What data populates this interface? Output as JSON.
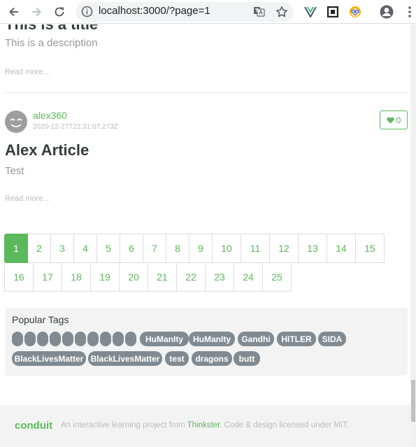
{
  "browser": {
    "url": "localhost:3000/?page=1",
    "icons": [
      "back-arrow-icon",
      "forward-arrow-icon",
      "reload-icon",
      "info-icon",
      "translate-icon",
      "star-icon",
      "vue-devtools-icon",
      "extension-square-icon",
      "extension-avatar-icon",
      "profile-icon",
      "menu-dots-icon"
    ]
  },
  "articles": [
    {
      "title": "This is a title",
      "description": "This is a description",
      "read_more": "Read more..."
    },
    {
      "author": "alex360",
      "date": "2020-12-27T22:31:07.273Z",
      "favorites": "0",
      "title": "Alex Article",
      "description": "Test",
      "read_more": "Read more..."
    }
  ],
  "pagination": {
    "pages": [
      "1",
      "2",
      "3",
      "4",
      "5",
      "6",
      "7",
      "8",
      "9",
      "10",
      "11",
      "12",
      "13",
      "14",
      "15",
      "16",
      "17",
      "18",
      "19",
      "20",
      "21",
      "22",
      "23",
      "24",
      "25"
    ],
    "active": "1"
  },
  "sidebar": {
    "title": "Popular Tags",
    "tags": [
      "",
      "",
      "",
      "",
      "",
      "",
      "",
      "",
      "",
      "",
      "HuManIty",
      "HuManIty",
      "Gandhi",
      "HITLER",
      "SIDA",
      "BlackLivesMatter",
      "BlackLivesMatter",
      "test",
      "dragons",
      "butt"
    ]
  },
  "footer": {
    "logo": "conduit",
    "text_before": "An interactive learning project from ",
    "link": "Thinkster",
    "text_after": ". Code & design licensed under MIT."
  },
  "colors": {
    "brand": "#5cb85c",
    "tag": "#818a91"
  }
}
